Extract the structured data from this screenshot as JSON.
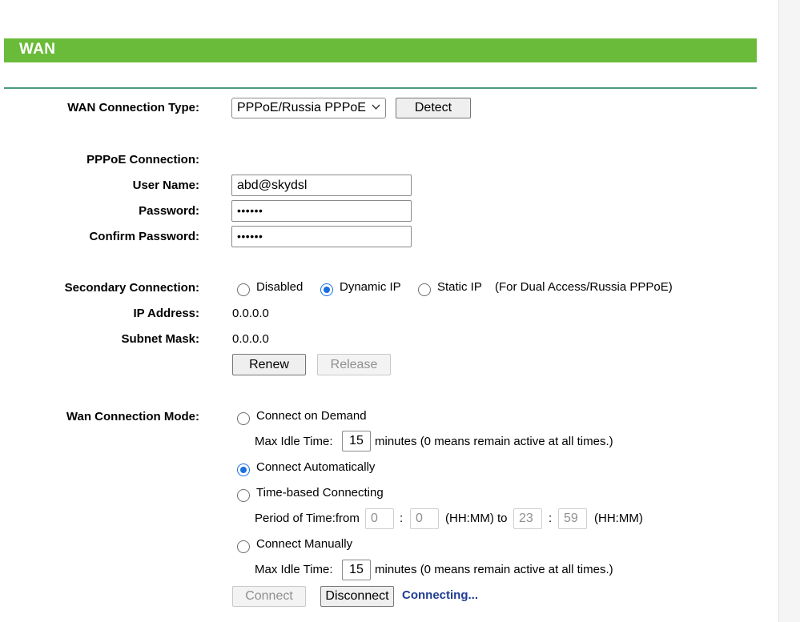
{
  "header": {
    "title": "WAN"
  },
  "wan_type": {
    "label": "WAN Connection Type:",
    "selected": "PPPoE/Russia PPPoE",
    "detect_button": "Detect"
  },
  "pppoe": {
    "section_label": "PPPoE Connection:",
    "username_label": "User Name:",
    "username_value": "abd@skydsl",
    "password_label": "Password:",
    "password_value": "••••••",
    "confirm_label": "Confirm Password:",
    "confirm_value": "••••••"
  },
  "secondary": {
    "label": "Secondary Connection:",
    "options": [
      "Disabled",
      "Dynamic IP",
      "Static IP"
    ],
    "selected": "Dynamic IP",
    "note": "(For Dual Access/Russia PPPoE)",
    "ip_label": "IP Address:",
    "ip_value": "0.0.0.0",
    "mask_label": "Subnet Mask:",
    "mask_value": "0.0.0.0",
    "renew_button": "Renew",
    "release_button": "Release"
  },
  "mode": {
    "label": "Wan Connection Mode:",
    "on_demand": "Connect on Demand",
    "max_idle_label": "Max Idle Time:",
    "max_idle_value_1": "15",
    "max_idle_suffix": "minutes (0 means remain active at all times.)",
    "auto": "Connect Automatically",
    "time_based": "Time-based Connecting",
    "period_label": "Period of Time:from",
    "from_hh": "0",
    "colon": ":",
    "from_mm": "0",
    "hhmm_to": "(HH:MM) to",
    "to_hh": "23",
    "to_mm": "59",
    "hhmm": "(HH:MM)",
    "manual": "Connect Manually",
    "max_idle_value_2": "15",
    "selected": "Connect Automatically"
  },
  "actions": {
    "connect_button": "Connect",
    "disconnect_button": "Disconnect",
    "status": "Connecting..."
  },
  "colors": {
    "header_bg": "#6bbb3a",
    "divider": "#4a9a7c",
    "radio_checked": "#1a6fe0",
    "status_text": "#1f3c94"
  }
}
